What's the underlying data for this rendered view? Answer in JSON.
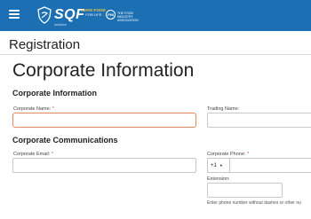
{
  "header": {
    "logo_text": "SQF",
    "logo_sub": "institute",
    "partner_top": "SAFE FOOD",
    "partner_bottom": "FOR LIFE",
    "fmi_badge": "FMI",
    "fmi_text": "THE FOOD INDUSTRY ASSOCIATION",
    "bar_color": "#1d6fb3"
  },
  "page": {
    "title": "Registration"
  },
  "form": {
    "heading": "Corporate Information",
    "corporate_info": {
      "section_title": "Corporate Information",
      "corporate_name_label": "Corporate Name:",
      "corporate_name_value": "",
      "trading_name_label": "Trading Name:",
      "trading_name_value": ""
    },
    "communications": {
      "section_title": "Corporate Communications",
      "email_label": "Corporate Email:",
      "email_value": "",
      "phone_label": "Corporate Phone:",
      "phone_country_code": "+1",
      "phone_value": "",
      "extension_label": "Extension:",
      "extension_value": "",
      "phone_help": "Enter phone number without dashes or other nu"
    },
    "required_mark": "*",
    "focus_color": "#e4875c",
    "required_color": "#d9534f"
  }
}
